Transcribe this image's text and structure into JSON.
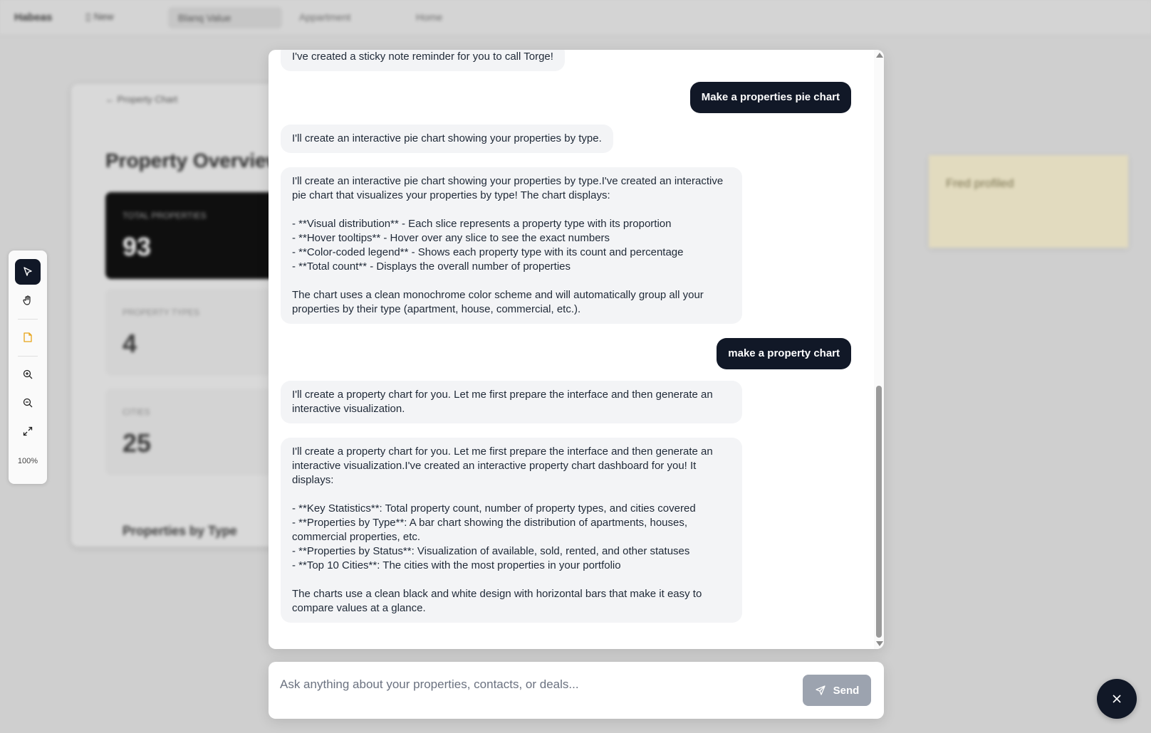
{
  "background": {
    "brand": "Habeas",
    "new_label": "New",
    "search_pill": "Blanq Value",
    "nav_1": "Appartment",
    "nav_2": "Home",
    "card_title": "Property Chart",
    "overview_title": "Property Overview",
    "stats": [
      {
        "label": "TOTAL PROPERTIES",
        "value": "93"
      },
      {
        "label": "PROPERTY TYPES",
        "value": "4"
      },
      {
        "label": "CITIES",
        "value": "25"
      }
    ],
    "section_title": "Properties by Type",
    "sticky_note": "Fred profiled"
  },
  "toolbar": {
    "tools": [
      {
        "icon": "cursor-icon"
      },
      {
        "icon": "hand-icon"
      },
      {
        "icon": "sticky-note-icon"
      },
      {
        "icon": "zoom-in-icon"
      },
      {
        "icon": "zoom-out-icon"
      },
      {
        "icon": "expand-icon"
      }
    ],
    "zoom_level": "100%",
    "active_color": "#111827",
    "note_color": "#e8a317"
  },
  "chat": {
    "messages": [
      {
        "role": "assistant",
        "text": "I've created a sticky note reminder for you to call Torge!"
      },
      {
        "role": "user",
        "text": "Make a properties pie chart"
      },
      {
        "role": "assistant",
        "text": "I'll create an interactive pie chart showing your properties by type."
      },
      {
        "role": "assistant",
        "text": "I'll create an interactive pie chart showing your properties by type.I've created an interactive\npie chart that visualizes your properties by type! The chart displays:\n\n- **Visual distribution** - Each slice represents a property type with its proportion\n- **Hover tooltips** - Hover over any slice to see the exact numbers\n- **Color-coded legend** - Shows each property type with its count and percentage\n- **Total count** - Displays the overall number of properties\n\nThe chart uses a clean monochrome color scheme and will automatically group all your\nproperties by their type (apartment, house, commercial, etc.)."
      },
      {
        "role": "user",
        "text": "make a property chart"
      },
      {
        "role": "assistant",
        "text": "I'll create a property chart for you. Let me first prepare the interface and then generate an\ninteractive visualization."
      },
      {
        "role": "assistant",
        "text": "I'll create a property chart for you. Let me first prepare the interface and then generate an\ninteractive visualization.I've created an interactive property chart dashboard for you! It\ndisplays:\n\n- **Key Statistics**: Total property count, number of property types, and cities covered\n- **Properties by Type**: A bar chart showing the distribution of apartments, houses,\ncommercial properties, etc.\n- **Properties by Status**: Visualization of available, sold, rented, and other statuses\n- **Top 10 Cities**: The cities with the most properties in your portfolio\n\nThe charts use a clean black and white design with horizontal bars that make it easy to\ncompare values at a glance."
      }
    ],
    "user_bubble_color": "#111827",
    "assistant_bubble_color": "#f3f4f6"
  },
  "input": {
    "placeholder": "Ask anything about your properties, contacts, or deals...",
    "value": "",
    "send_label": "Send",
    "send_icon": "send-icon"
  },
  "close_button": {
    "icon": "close-icon"
  }
}
